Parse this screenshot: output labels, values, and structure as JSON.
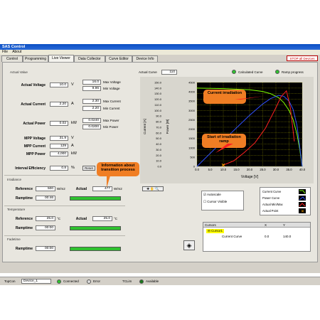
{
  "window": {
    "title": "SAS Control"
  },
  "menu": [
    "File",
    "About"
  ],
  "tabs": [
    "Control",
    "Programming",
    "Live Viewer",
    "Data Collector",
    "Curve Editor",
    "Device Info"
  ],
  "active_tab": "Live Viewer",
  "stop_all_label": "STOP all Devices",
  "actual_value": {
    "section": "Actual Value",
    "voltage": {
      "label": "Actual Voltage",
      "value": "10.0",
      "unit": "V",
      "max": "16.0",
      "min": "9.96",
      "max_label": "Max Voltage",
      "min_label": "Min Voltage"
    },
    "current": {
      "label": "Actual Current",
      "value": "2.20",
      "unit": "A",
      "max": "2.30",
      "min": "2.20",
      "max_label": "Max Current",
      "min_label": "Min Current"
    },
    "power": {
      "label": "Actual Power",
      "value": "0.02",
      "unit": "kW",
      "max": "0.0240",
      "min": "0.0200",
      "max_label": "Max Power",
      "min_label": "Min Power"
    },
    "mpp_voltage": {
      "label": "MPP Voltage",
      "value": "31.9",
      "unit": "V"
    },
    "mpp_current": {
      "label": "MPP Current",
      "value": "129",
      "unit": "A"
    },
    "mpp_power": {
      "label": "MPP Power",
      "value": "4,000",
      "unit": "kW"
    },
    "interval_efficiency": {
      "label": "Interval Efficiency",
      "value": "0.8",
      "unit": "%"
    },
    "reset_label": "Reset"
  },
  "irradiance": {
    "section": "Irradiance",
    "reference_label": "Reference",
    "reference": "500",
    "reference_unit": "W/m2",
    "actual_label": "Actual",
    "actual": "477",
    "actual_unit": "W/m2",
    "ramptime_label": "Ramptime",
    "ramptime": "00:46"
  },
  "temperature": {
    "section": "Temperature",
    "reference_label": "Reference",
    "reference": "25.0",
    "reference_unit": "°C",
    "actual_label": "Actual",
    "actual": "25.0",
    "actual_unit": "°C",
    "ramptime_label": "Ramptime",
    "ramptime": "00:00"
  },
  "fadetime": {
    "section": "Fadetime",
    "ramptime_label": "Ramptime",
    "ramptime": "00:00"
  },
  "chart_header": {
    "actual_curve_label": "Actual Curve",
    "actual_curve_value": "110",
    "calculated_curve_label": "Calculated Curve",
    "ramp_progress_label": "Ramp progress"
  },
  "options": {
    "autoscale_label": "Autoscale",
    "cursor_visible_label": "Cursor Visible"
  },
  "callouts": {
    "current_irradiation": "Current irradiation",
    "start_ramp": "Start of irradiation ramp",
    "transition": "Information about transition process"
  },
  "chart_legend": [
    "Current Curve",
    "Power Curve",
    "Actual Min/Max",
    "Actual Point"
  ],
  "cursors": {
    "headers": [
      "Cursors",
      "X",
      "Y"
    ],
    "name": "Cursor1",
    "row_label": "Current Curve",
    "x": "0.0",
    "y": "140.0"
  },
  "status": {
    "topcon_label": "TopCon",
    "device": "Device_1",
    "connected_label": "Connected",
    "error_label": "Error",
    "tclim_label": "TCLim",
    "available_label": "Available"
  },
  "colors": {
    "curve_green": "#7fff00",
    "curve_blue": "#3050ff",
    "curve_red": "#ff2020",
    "grid_yellow": "#b0b000",
    "callout": "#f07e24"
  },
  "chart_data": {
    "type": "line",
    "xlabel": "Voltage [V]",
    "ylabel": "Current [A]",
    "ylabel2": "Power [W]",
    "xlim": [
      0,
      40
    ],
    "ylim": [
      0,
      150
    ],
    "ylim2": [
      0,
      4500
    ],
    "x_ticks": [
      "0.0",
      "5.0",
      "10.0",
      "15.0",
      "20.0",
      "25.0",
      "30.0",
      "35.0",
      "40.0"
    ],
    "y_ticks": [
      "0.0",
      "10.0",
      "20.0",
      "30.0",
      "40.0",
      "50.0",
      "60.0",
      "70.0",
      "80.0",
      "90.0",
      "100.0",
      "110.0",
      "120.0",
      "130.0",
      "140.0",
      "150.0"
    ],
    "y2_ticks": [
      "0",
      "500",
      "1000",
      "1500",
      "2000",
      "2500",
      "3000",
      "3500",
      "4000",
      "4500"
    ],
    "series": [
      {
        "name": "Current Curve",
        "color": "#7fff00",
        "x": [
          0,
          10,
          20,
          25,
          28,
          31,
          33,
          35,
          36.5,
          38,
          39,
          40
        ],
        "y": [
          140,
          139,
          137,
          134,
          130,
          123,
          114,
          100,
          84,
          58,
          32,
          0
        ]
      },
      {
        "name": "Power Curve",
        "color": "#3050ff",
        "x": [
          0,
          10,
          20,
          25,
          28,
          31,
          33,
          35,
          36.5,
          38,
          40
        ],
        "y": [
          0,
          1390,
          2740,
          3350,
          3640,
          3810,
          3760,
          3500,
          3070,
          2200,
          0
        ],
        "axis": "y2"
      },
      {
        "name": "Actual Min/Max",
        "color": "#ff2020",
        "x": [
          10,
          14,
          18,
          22,
          26,
          30,
          32,
          34,
          35.5,
          37
        ],
        "y": [
          2.3,
          10,
          25,
          42,
          68,
          105,
          125,
          135,
          105,
          45
        ]
      }
    ],
    "actual_point": {
      "x": 10,
      "y": 2.2
    }
  }
}
